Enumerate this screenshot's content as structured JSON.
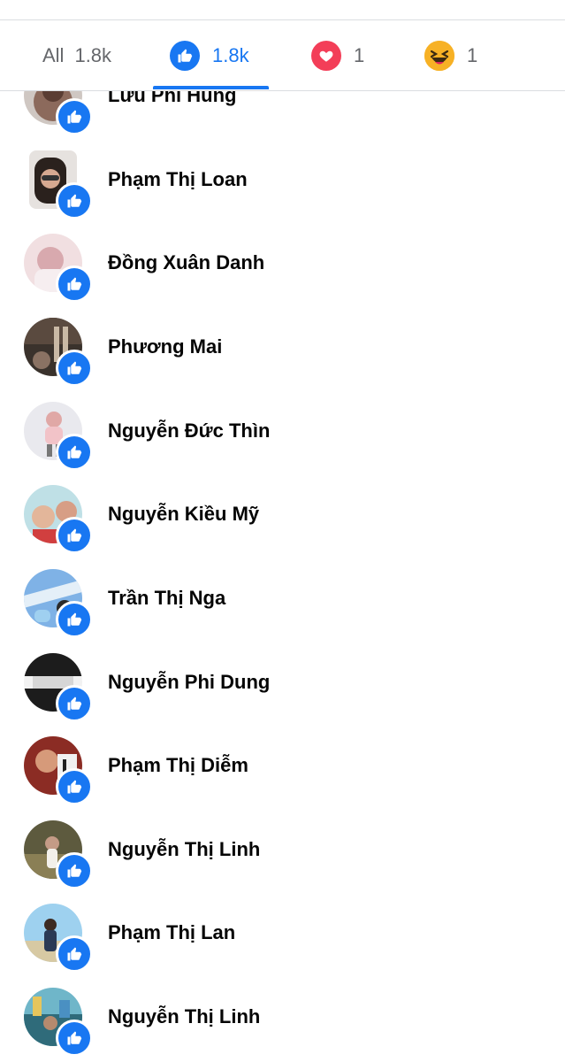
{
  "tabs": [
    {
      "label": "All",
      "count": "1.8k"
    },
    {
      "label": "",
      "count": "1.8k",
      "icon": "like-reaction-icon"
    },
    {
      "label": "",
      "count": "1",
      "icon": "love-reaction-icon"
    },
    {
      "label": "",
      "count": "1",
      "icon": "haha-reaction-icon"
    }
  ],
  "colors": {
    "accent": "#1877f2",
    "love": "#f33e58",
    "haha": "#f7b125",
    "text": "#050505",
    "muted": "#65676b"
  },
  "people": [
    {
      "name": "Lưu Phi Hùng"
    },
    {
      "name": "Phạm Thị Loan"
    },
    {
      "name": "Đồng Xuân Danh"
    },
    {
      "name": "Phương Mai"
    },
    {
      "name": "Nguyễn Đức Thìn"
    },
    {
      "name": "Nguyễn Kiều Mỹ"
    },
    {
      "name": "Trần Thị Nga"
    },
    {
      "name": "Nguyễn Phi Dung"
    },
    {
      "name": "Phạm Thị Diễm"
    },
    {
      "name": "Nguyễn Thị Linh"
    },
    {
      "name": "Phạm Thị Lan"
    },
    {
      "name": "Nguyễn Thị Linh"
    }
  ]
}
